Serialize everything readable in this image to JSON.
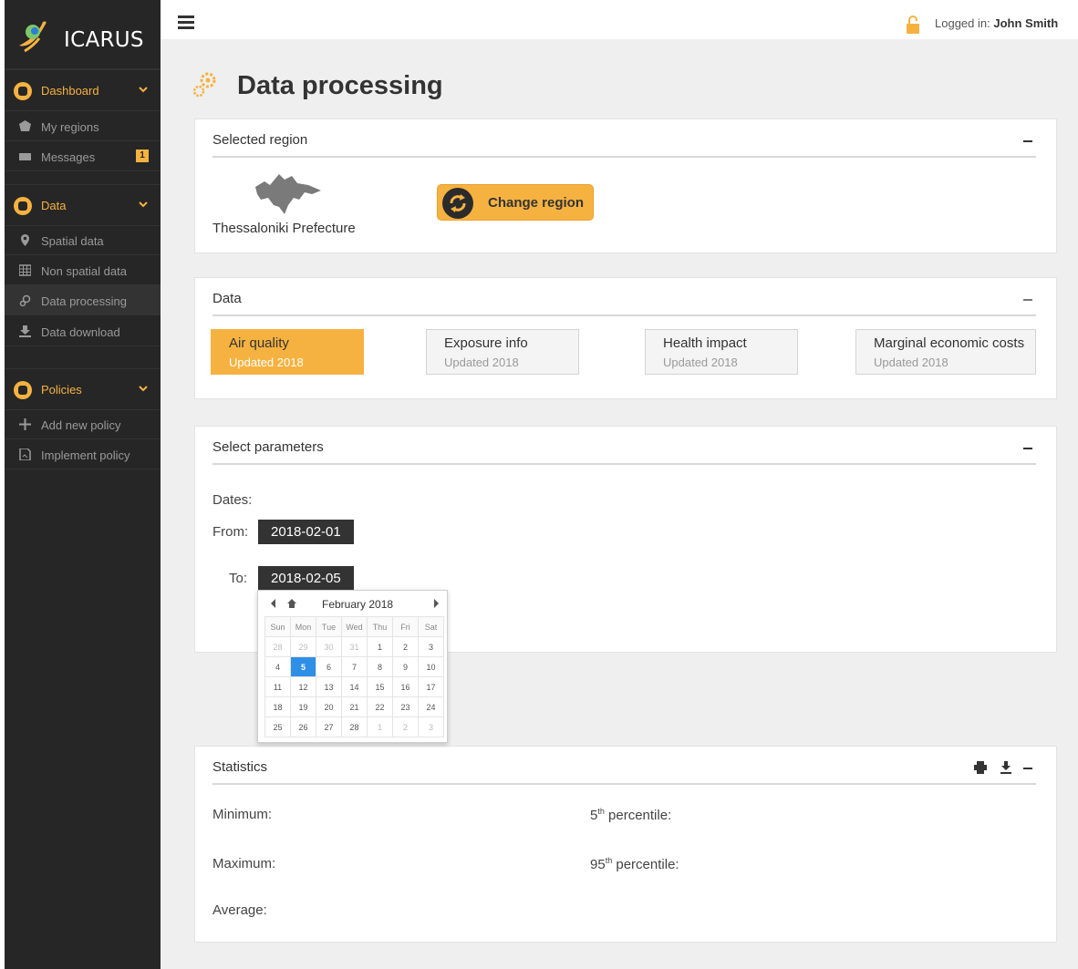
{
  "app": {
    "name": "ICARUS"
  },
  "sidebar": {
    "sections": [
      {
        "label": "Dashboard",
        "items": [
          {
            "label": "My regions"
          },
          {
            "label": "Messages",
            "badge": "1"
          }
        ]
      },
      {
        "label": "Data",
        "items": [
          {
            "label": "Spatial data"
          },
          {
            "label": "Non spatial data"
          },
          {
            "label": "Data processing"
          },
          {
            "label": "Data download"
          }
        ]
      },
      {
        "label": "Policies",
        "items": [
          {
            "label": "Add new policy"
          },
          {
            "label": "Implement policy"
          }
        ]
      }
    ],
    "active_item": "Data processing"
  },
  "topbar": {
    "login_prefix": "Logged in:",
    "user": "John Smith"
  },
  "page": {
    "title": "Data processing"
  },
  "region_panel": {
    "title": "Selected region",
    "region_name": "Thessaloniki Prefecture",
    "button_label": "Change region"
  },
  "data_panel": {
    "title": "Data",
    "tabs": [
      {
        "name": "Air quality",
        "updated": "Updated 2018",
        "active": true
      },
      {
        "name": "Exposure info",
        "updated": "Updated 2018",
        "active": false
      },
      {
        "name": "Health impact",
        "updated": "Updated 2018",
        "active": false
      },
      {
        "name": "Marginal economic costs",
        "updated": "Updated 2018",
        "active": false
      }
    ]
  },
  "params_panel": {
    "title": "Select parameters",
    "dates_label": "Dates:",
    "from_label": "From:",
    "from_value": "2018-02-01",
    "to_label": "To:",
    "to_value": "2018-02-05"
  },
  "calendar": {
    "month": "February",
    "year": "2018",
    "weekdays": [
      "Sun",
      "Mon",
      "Tue",
      "Wed",
      "Thu",
      "Fri",
      "Sat"
    ],
    "weeks": [
      [
        "28",
        "29",
        "30",
        "31",
        "1",
        "2",
        "3"
      ],
      [
        "4",
        "5",
        "6",
        "7",
        "8",
        "9",
        "10"
      ],
      [
        "11",
        "12",
        "13",
        "14",
        "15",
        "16",
        "17"
      ],
      [
        "18",
        "19",
        "20",
        "21",
        "22",
        "23",
        "24"
      ],
      [
        "25",
        "26",
        "27",
        "28",
        "1",
        "2",
        "3"
      ]
    ],
    "selected_day": "5"
  },
  "stats_panel": {
    "title": "Statistics",
    "minimum_label": "Minimum:",
    "maximum_label": "Maximum:",
    "average_label": "Average:",
    "p5_number": "5",
    "p95_number": "95",
    "ordinal_suffix": "th",
    "percentile_label": " percentile:"
  },
  "colors": {
    "accent": "#f6b240",
    "sidebar_bg": "#262626",
    "selected_day": "#2f8fe6"
  },
  "icons": [
    "icarus-logo-icon",
    "hamburger-menu-icon",
    "lock-icon",
    "gears-icon",
    "refresh-icon",
    "print-icon",
    "download-icon",
    "collapse-icon"
  ]
}
